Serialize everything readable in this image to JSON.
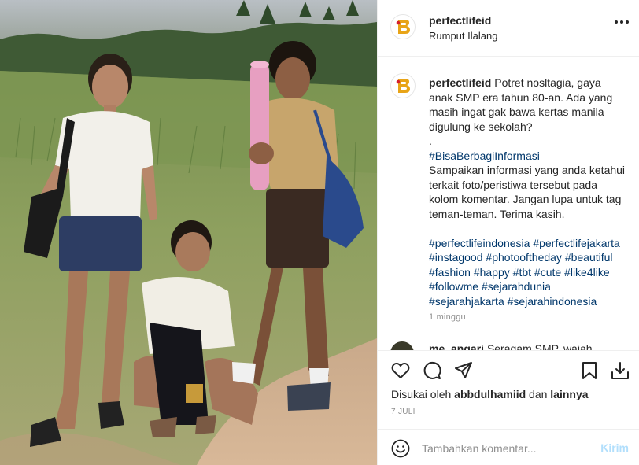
{
  "header": {
    "username": "perfectlifeid",
    "location": "Rumput Ilalang"
  },
  "caption": {
    "username": "perfectlifeid",
    "text_intro": "Potret nosltagia, gaya anak SMP era tahun 80-an. Ada yang masih ingat gak bawa kertas manila digulung ke sekolah?",
    "dot": ".",
    "hashtag_share": "#BisaBerbagiInformasi",
    "text_body": "Sampaikan informasi yang anda ketahui terkait foto/peristiwa tersebut pada kolom komentar. Jangan lupa untuk tag teman-teman. Terima kasih.",
    "hashtags": [
      "#perfectlifeindonesia",
      "#perfectlifejakarta",
      "#instagood",
      "#photooftheday",
      "#beautiful",
      "#fashion",
      "#happy",
      "#tbt",
      "#cute",
      "#like4like",
      "#followme",
      "#sejarahdunia",
      "#sejarahjakarta",
      "#sejarahindonesia"
    ],
    "time_ago": "1 minggu"
  },
  "next_comment": {
    "username": "me_angari",
    "text": "Seragam SMP, wajah"
  },
  "actions": {
    "like_icon": "heart-icon",
    "comment_icon": "comment-icon",
    "share_icon": "paper-plane-icon",
    "save_icon": "bookmark-icon",
    "download_icon": "download-icon"
  },
  "likes": {
    "prefix": "Disukai oleh",
    "user": "abbdulhamiid",
    "conj": "dan",
    "others": "lainnya"
  },
  "date": "7 JULI",
  "add_comment": {
    "placeholder": "Tambahkan komentar...",
    "post_label": "Kirim"
  },
  "colors": {
    "link": "#00376b",
    "muted": "#8e8e8e",
    "post_button_disabled": "#b2dffc",
    "logo_red": "#d4202c",
    "logo_gold": "#e8a417"
  }
}
